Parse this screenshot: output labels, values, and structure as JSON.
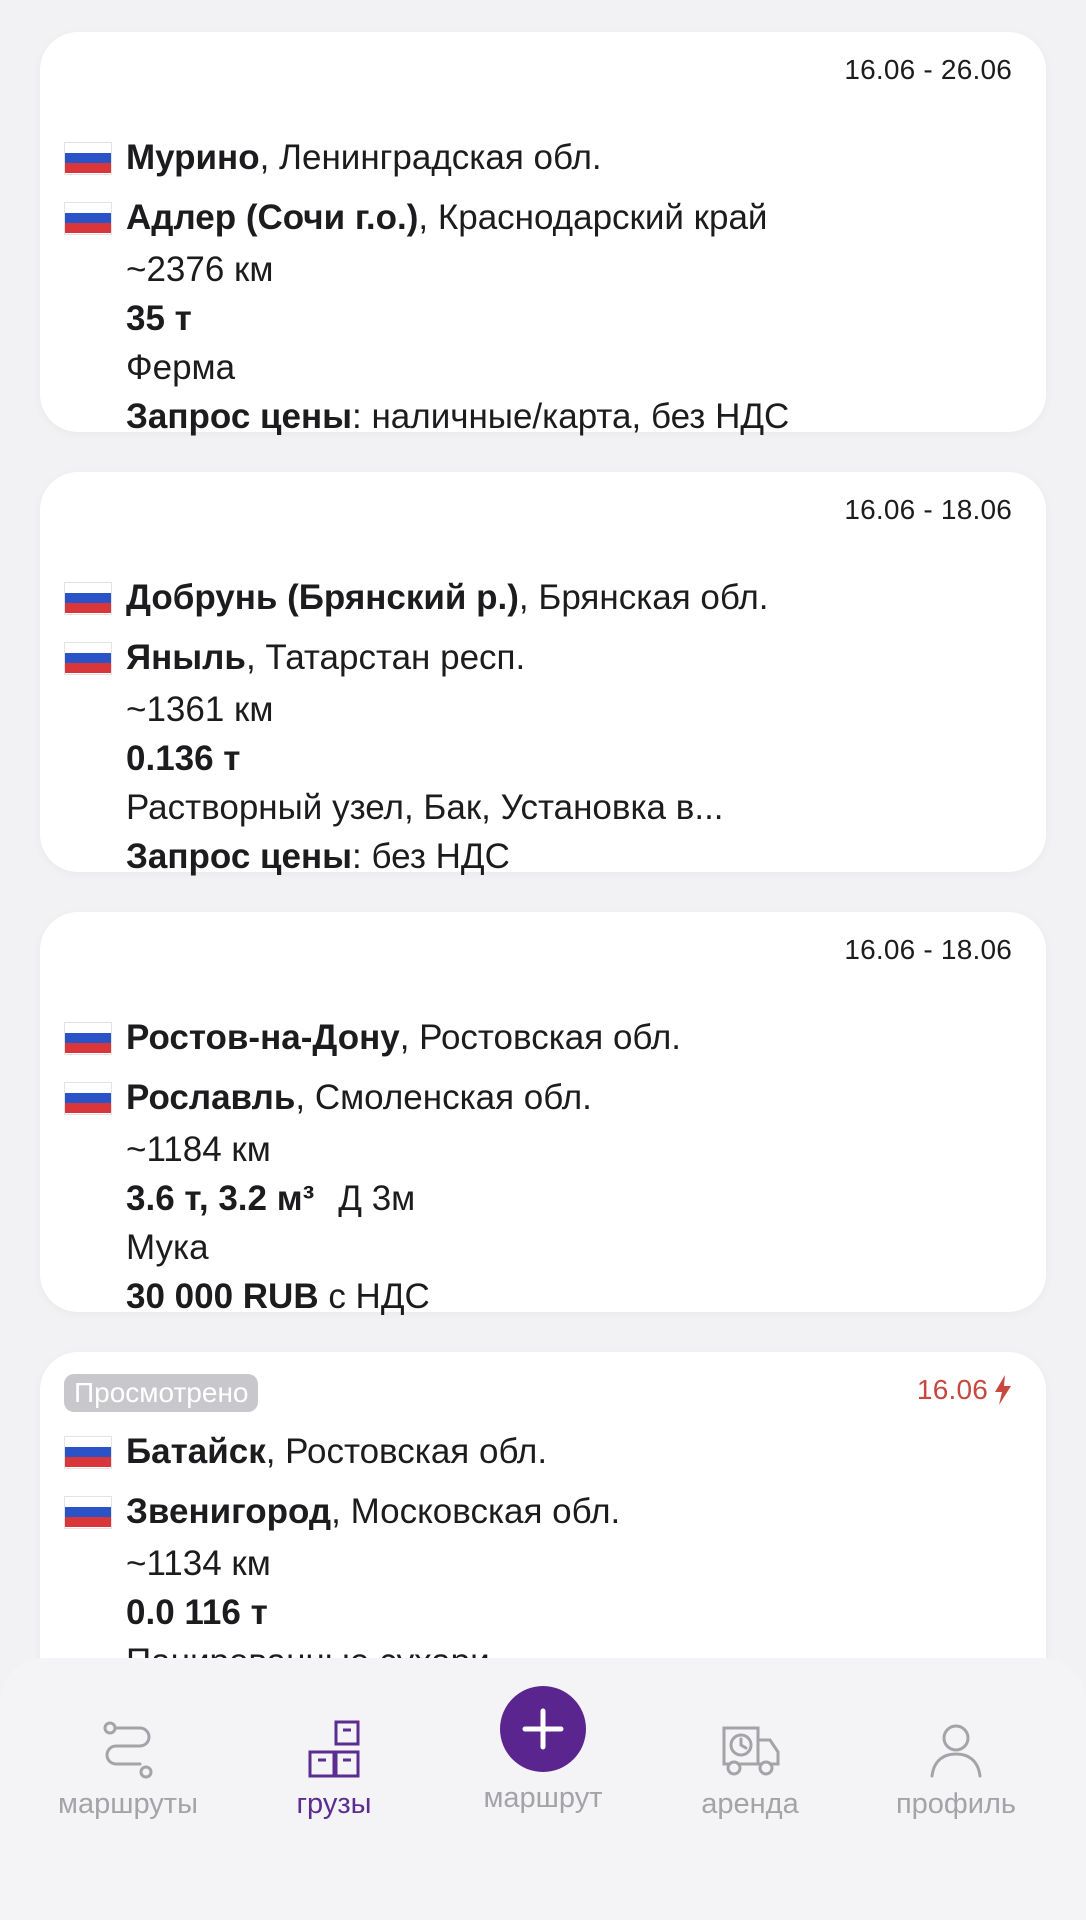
{
  "cards": [
    {
      "date": "16.06 - 26.06",
      "from_city": "Мурино",
      "from_region": ", Ленинградская обл.",
      "to_city": "Адлер (Сочи г.о.)",
      "to_region": ", Краснодарский край",
      "distance": "~2376 км",
      "weight": "35 т",
      "cargo": "Ферма",
      "price_bold": "Запрос цены",
      "price_rest": ": наличные/карта, без НДС"
    },
    {
      "date": "16.06 - 18.06",
      "from_city": "Добрунь (Брянский р.)",
      "from_region": ", Брянская обл.",
      "to_city": "Яныль",
      "to_region": ", Татарстан респ.",
      "distance": "~1361 км",
      "weight": "0.136 т",
      "cargo": "Растворный узел, Бак, Установка в...",
      "price_bold": "Запрос цены",
      "price_rest": ": без НДС"
    },
    {
      "date": "16.06 - 18.06",
      "from_city": "Ростов-на-Дону",
      "from_region": ", Ростовская обл.",
      "to_city": "Рославль",
      "to_region": ", Смоленская обл.",
      "distance": "~1184 км",
      "weight": "3.6 т, 3.2 м³",
      "weight_extra": "Д 3м",
      "cargo": "Мука",
      "price_bold": "30 000 RUB",
      "price_rest": " с НДС"
    },
    {
      "badge": "Просмотрено",
      "date": "16.06",
      "from_city": "Батайск",
      "from_region": ", Ростовская обл.",
      "to_city": "Звенигород",
      "to_region": ", Московская обл.",
      "distance": "~1134 км",
      "weight": "0.0 116 т",
      "cargo": "Панированные сухари"
    }
  ],
  "icons": {
    "flag": "russia-flag-icon",
    "urgent": "lightning-icon"
  },
  "nav": {
    "routes": "маршруты",
    "cargo": "грузы",
    "add_route": "маршрут",
    "rent": "аренда",
    "profile": "профиль"
  },
  "colors": {
    "accent": "#5b2590",
    "urgent": "#c8473f",
    "inactive": "#a4a4a8"
  }
}
